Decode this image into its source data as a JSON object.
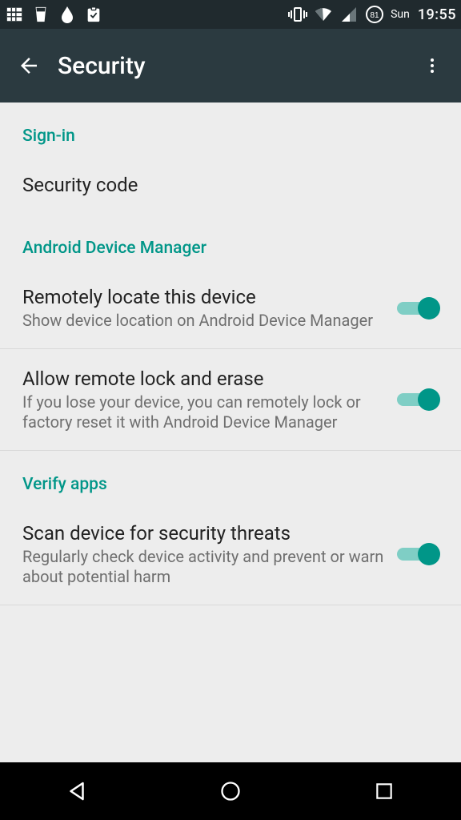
{
  "status": {
    "battery_pct": "81",
    "day": "Sun",
    "time": "19:55"
  },
  "appbar": {
    "title": "Security"
  },
  "sections": {
    "signin": {
      "header": "Sign-in",
      "security_code": "Security code"
    },
    "adm": {
      "header": "Android Device Manager",
      "locate_title": "Remotely locate this device",
      "locate_sub": "Show device location on Android Device Manager",
      "lock_title": "Allow remote lock and erase",
      "lock_sub": "If you lose your device, you can remotely lock or factory reset it with Android Device Manager"
    },
    "verify": {
      "header": "Verify apps",
      "scan_title": "Scan device for security threats",
      "scan_sub": "Regularly check device activity and prevent or warn about potential harm"
    }
  }
}
